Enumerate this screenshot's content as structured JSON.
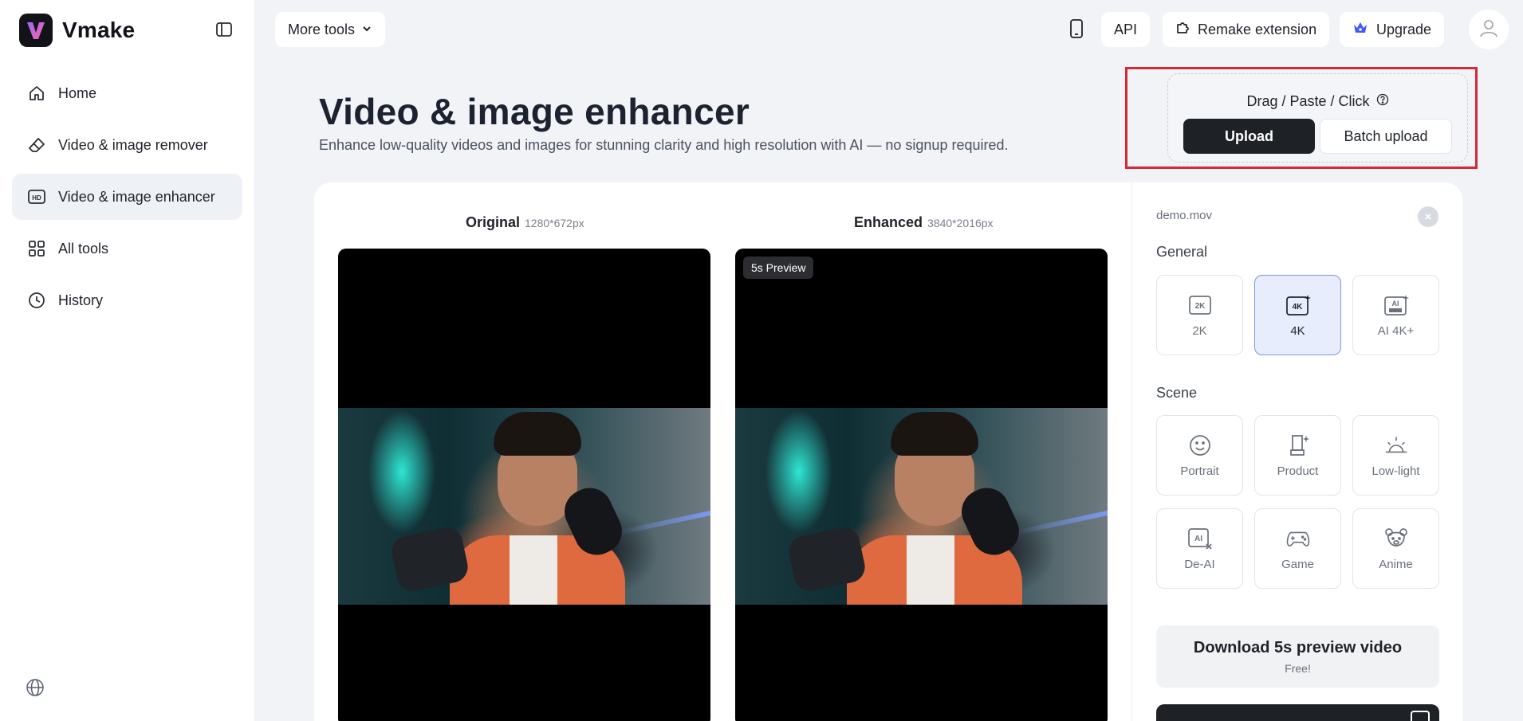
{
  "app": {
    "name": "Vmake"
  },
  "sidebar": {
    "items": [
      {
        "label": "Home",
        "icon": "home-icon"
      },
      {
        "label": "Video & image remover",
        "icon": "eraser-icon"
      },
      {
        "label": "Video & image enhancer",
        "icon": "hd-icon",
        "active": true
      },
      {
        "label": "All tools",
        "icon": "grid-icon"
      },
      {
        "label": "History",
        "icon": "clock-icon"
      }
    ]
  },
  "topbar": {
    "more_tools": "More tools",
    "api": "API",
    "remake_extension": "Remake extension",
    "upgrade": "Upgrade"
  },
  "header": {
    "title": "Video & image enhancer",
    "subtitle": "Enhance low-quality videos and images for stunning clarity and high resolution with AI — no signup required."
  },
  "upload": {
    "hint": "Drag / Paste / Click",
    "upload_label": "Upload",
    "batch_label": "Batch upload"
  },
  "compare": {
    "original_label": "Original",
    "original_dim": "1280*672px",
    "enhanced_label": "Enhanced",
    "enhanced_dim": "3840*2016px",
    "preview_badge": "5s Preview"
  },
  "panel": {
    "file_name": "demo.mov",
    "general_title": "General",
    "general": [
      {
        "label": "2K",
        "icon": "2k-icon"
      },
      {
        "label": "4K",
        "icon": "4k-icon",
        "selected": true
      },
      {
        "label": "AI 4K+",
        "icon": "ai-ultra-icon"
      }
    ],
    "scene_title": "Scene",
    "scene": [
      {
        "label": "Portrait",
        "icon": "smile-icon"
      },
      {
        "label": "Product",
        "icon": "product-icon"
      },
      {
        "label": "Low-light",
        "icon": "sunrise-icon"
      },
      {
        "label": "De-AI",
        "icon": "de-ai-icon"
      },
      {
        "label": "Game",
        "icon": "gamepad-icon"
      },
      {
        "label": "Anime",
        "icon": "anime-bear-icon"
      }
    ],
    "download_main": "Download 5s preview video",
    "download_sub": "Free!"
  },
  "colors": {
    "accent_red": "#d42a36",
    "selected_bg": "#e7edfc",
    "dark": "#1e2126"
  }
}
